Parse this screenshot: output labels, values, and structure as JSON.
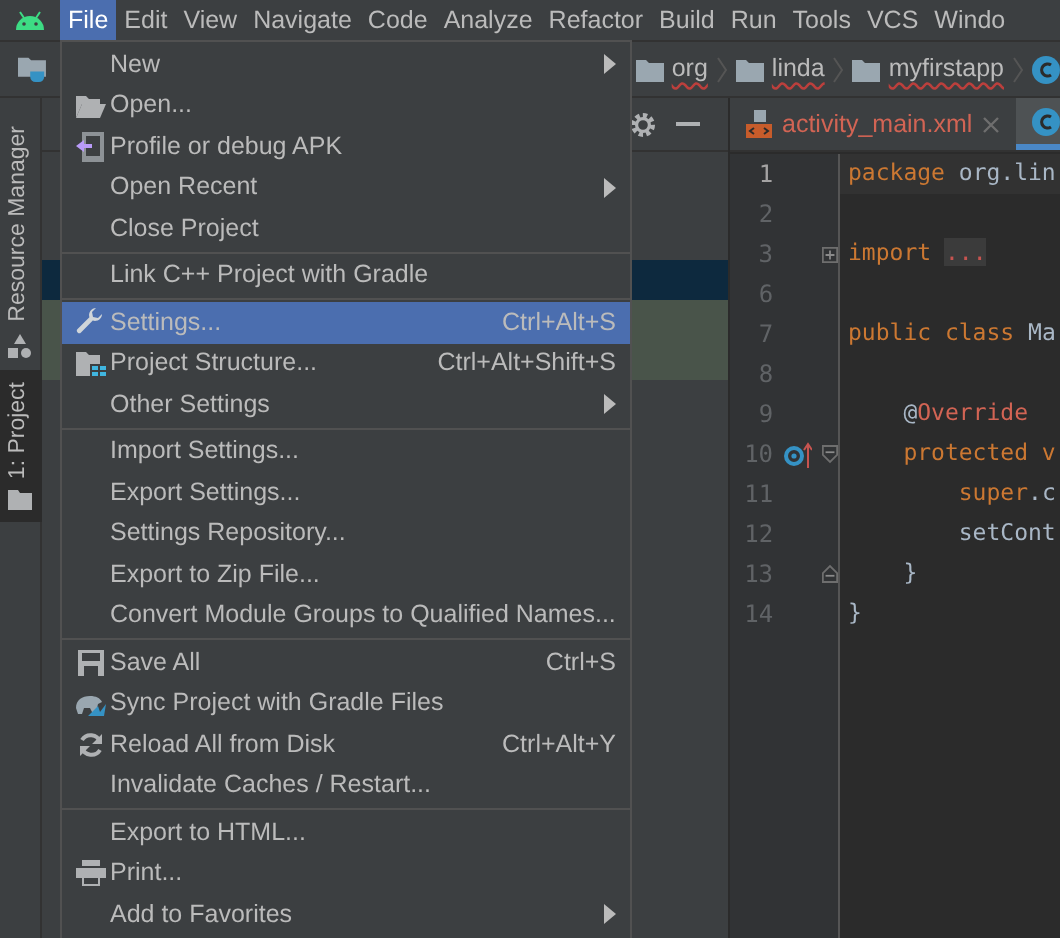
{
  "menubar": [
    {
      "label": "File",
      "selected": true
    },
    {
      "label": "Edit",
      "selected": false
    },
    {
      "label": "View",
      "selected": false
    },
    {
      "label": "Navigate",
      "selected": false
    },
    {
      "label": "Code",
      "selected": false
    },
    {
      "label": "Analyze",
      "selected": false
    },
    {
      "label": "Refactor",
      "selected": false
    },
    {
      "label": "Build",
      "selected": false
    },
    {
      "label": "Run",
      "selected": false
    },
    {
      "label": "Tools",
      "selected": false
    },
    {
      "label": "VCS",
      "selected": false
    },
    {
      "label": "Windo",
      "selected": false
    }
  ],
  "breadcrumbs": [
    "org",
    "linda",
    "myfirstapp"
  ],
  "side_tabs": [
    {
      "label": "Resource Manager",
      "selected": false
    },
    {
      "label": "1: Project",
      "selected": true
    }
  ],
  "editor_tabs": [
    {
      "kind": "xml",
      "label": "activity_main.xml",
      "selected": false
    },
    {
      "kind": "class",
      "selected": true
    }
  ],
  "code": [
    {
      "number": "1",
      "current": true,
      "kind": "plain",
      "tokens": [
        {
          "text": "package ",
          "kind": "keyword"
        },
        {
          "text": "org.lin",
          "kind": "plain"
        }
      ]
    },
    {
      "number": "2",
      "current": false,
      "kind": "plain"
    },
    {
      "number": "3",
      "current": false,
      "kind": "fold-expand",
      "tokens": [
        {
          "text": "import ",
          "kind": "keyword"
        },
        {
          "text": "...",
          "kind": "folded"
        }
      ]
    },
    {
      "number": "6",
      "current": false,
      "kind": "plain"
    },
    {
      "number": "7",
      "current": false,
      "kind": "plain",
      "tokens": [
        {
          "text": "public class ",
          "kind": "keyword"
        },
        {
          "text": "Ma",
          "kind": "plain"
        }
      ]
    },
    {
      "number": "8",
      "current": false,
      "kind": "plain"
    },
    {
      "number": "9",
      "current": false,
      "kind": "plain",
      "tokens": [
        {
          "text": "    @",
          "kind": "plain"
        },
        {
          "text": "Override",
          "kind": "error"
        }
      ]
    },
    {
      "number": "10",
      "current": false,
      "kind": "fold-collapse",
      "tokens": [
        {
          "text": "    protected v",
          "kind": "keyword"
        }
      ]
    },
    {
      "number": "11",
      "current": false,
      "kind": "plain",
      "tokens": [
        {
          "text": "        super",
          "kind": "keyword"
        },
        {
          "text": ".c",
          "kind": "plain"
        }
      ]
    },
    {
      "number": "12",
      "current": false,
      "kind": "plain",
      "tokens": [
        {
          "text": "        setCont",
          "kind": "plain"
        }
      ]
    },
    {
      "number": "13",
      "current": false,
      "kind": "fold-end",
      "tokens": [
        {
          "text": "    }",
          "kind": "plain"
        }
      ]
    },
    {
      "number": "14",
      "current": false,
      "kind": "plain",
      "tokens": [
        {
          "text": "}",
          "kind": "plain"
        }
      ]
    }
  ],
  "file_menu": [
    {
      "kind": "item",
      "label": "New",
      "submenu": true,
      "selected": false
    },
    {
      "kind": "item",
      "label": "Open...",
      "submenu": false,
      "selected": false
    },
    {
      "kind": "item",
      "label": "Profile or debug APK",
      "submenu": false,
      "selected": false
    },
    {
      "kind": "item",
      "label": "Open Recent",
      "submenu": true,
      "selected": false
    },
    {
      "kind": "item",
      "label": "Close Project",
      "submenu": false,
      "selected": false
    },
    {
      "kind": "separator"
    },
    {
      "kind": "item",
      "label": "Link C++ Project with Gradle",
      "submenu": false,
      "selected": false
    },
    {
      "kind": "separator"
    },
    {
      "kind": "item",
      "label": "Settings...",
      "shortcut": "Ctrl+Alt+S",
      "submenu": false,
      "selected": true
    },
    {
      "kind": "item",
      "label": "Project Structure...",
      "shortcut": "Ctrl+Alt+Shift+S",
      "submenu": false,
      "selected": false
    },
    {
      "kind": "item",
      "label": "Other Settings",
      "submenu": true,
      "selected": false
    },
    {
      "kind": "separator"
    },
    {
      "kind": "item",
      "label": "Import Settings...",
      "submenu": false,
      "selected": false
    },
    {
      "kind": "item",
      "label": "Export Settings...",
      "submenu": false,
      "selected": false
    },
    {
      "kind": "item",
      "label": "Settings Repository...",
      "submenu": false,
      "selected": false
    },
    {
      "kind": "item",
      "label": "Export to Zip File...",
      "submenu": false,
      "selected": false
    },
    {
      "kind": "item",
      "label": "Convert Module Groups to Qualified Names...",
      "submenu": false,
      "selected": false
    },
    {
      "kind": "separator"
    },
    {
      "kind": "item",
      "label": "Save All",
      "shortcut": "Ctrl+S",
      "submenu": false,
      "selected": false
    },
    {
      "kind": "item",
      "label": "Sync Project with Gradle Files",
      "submenu": false,
      "selected": false
    },
    {
      "kind": "item",
      "label": "Reload All from Disk",
      "shortcut": "Ctrl+Alt+Y",
      "submenu": false,
      "selected": false
    },
    {
      "kind": "item",
      "label": "Invalidate Caches / Restart...",
      "submenu": false,
      "selected": false
    },
    {
      "kind": "separator"
    },
    {
      "kind": "item",
      "label": "Export to HTML...",
      "submenu": false,
      "selected": false
    },
    {
      "kind": "item",
      "label": "Print...",
      "submenu": false,
      "selected": false
    },
    {
      "kind": "item",
      "label": "Add to Favorites",
      "submenu": true,
      "selected": false
    }
  ]
}
